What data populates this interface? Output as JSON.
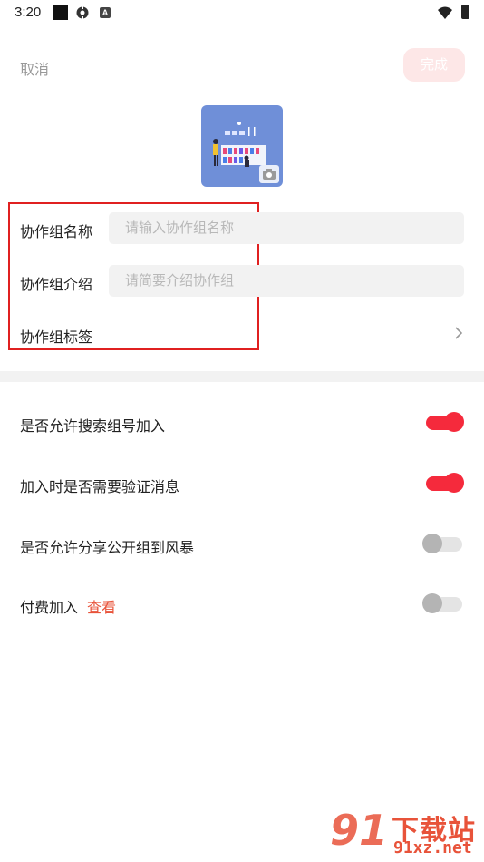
{
  "status_bar": {
    "time": "3:20"
  },
  "header": {
    "cancel_label": "取消",
    "done_label": "完成"
  },
  "form": {
    "name": {
      "label": "协作组名称",
      "placeholder": "请输入协作组名称",
      "value": ""
    },
    "intro": {
      "label": "协作组介绍",
      "placeholder": "请简要介绍协作组",
      "value": ""
    },
    "tags": {
      "label": "协作组标签"
    }
  },
  "settings": [
    {
      "label": "是否允许搜索组号加入",
      "on": true
    },
    {
      "label": "加入时是否需要验证消息",
      "on": true
    },
    {
      "label": "是否允许分享公开组到风暴",
      "on": false
    },
    {
      "label": "付费加入",
      "link_label": "查看",
      "on": false
    }
  ],
  "watermark": {
    "logo": "91",
    "title": "下载站",
    "url": "91xz.net"
  },
  "colors": {
    "accent": "#f52a3c",
    "done_button_bg": "#fde7e7",
    "link": "#e8533a",
    "highlight_border": "#e02020",
    "cover_bg": "#6f8fd8"
  }
}
